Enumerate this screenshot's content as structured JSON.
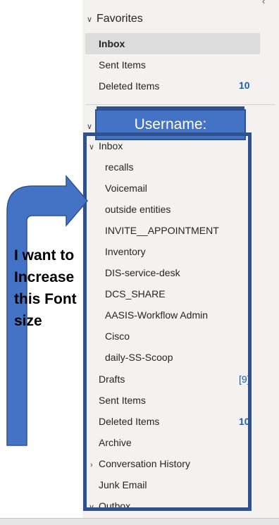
{
  "favorites": {
    "header": "Favorites",
    "items": [
      {
        "label": "Inbox",
        "count": ""
      },
      {
        "label": "Sent Items",
        "count": ""
      },
      {
        "label": "Deleted Items",
        "count": "10"
      }
    ]
  },
  "account": {
    "username_label": "Username:",
    "inbox_label": "Inbox",
    "inbox_subfolders": [
      "recalls",
      "Voicemail",
      "outside entities",
      "INVITE__APPOINTMENT",
      "Inventory",
      "DIS-service-desk",
      "DCS_SHARE",
      "AASIS-Workflow Admin",
      "Cisco",
      "daily-SS-Scoop"
    ],
    "drafts_label": "Drafts",
    "drafts_count": "[9]",
    "sent_label": "Sent Items",
    "deleted_label": "Deleted Items",
    "deleted_count": "10",
    "archive_label": "Archive",
    "conversation_label": "Conversation History",
    "junk_label": "Junk Email",
    "outbox_label": "Outbox"
  },
  "annotation": {
    "note": "I want to Increase this Font size"
  },
  "colors": {
    "accent_blue": "#4472c4",
    "border_blue": "#2f528f",
    "count_blue": "#1f5fa8",
    "pane_bg": "#f3f2f1"
  }
}
